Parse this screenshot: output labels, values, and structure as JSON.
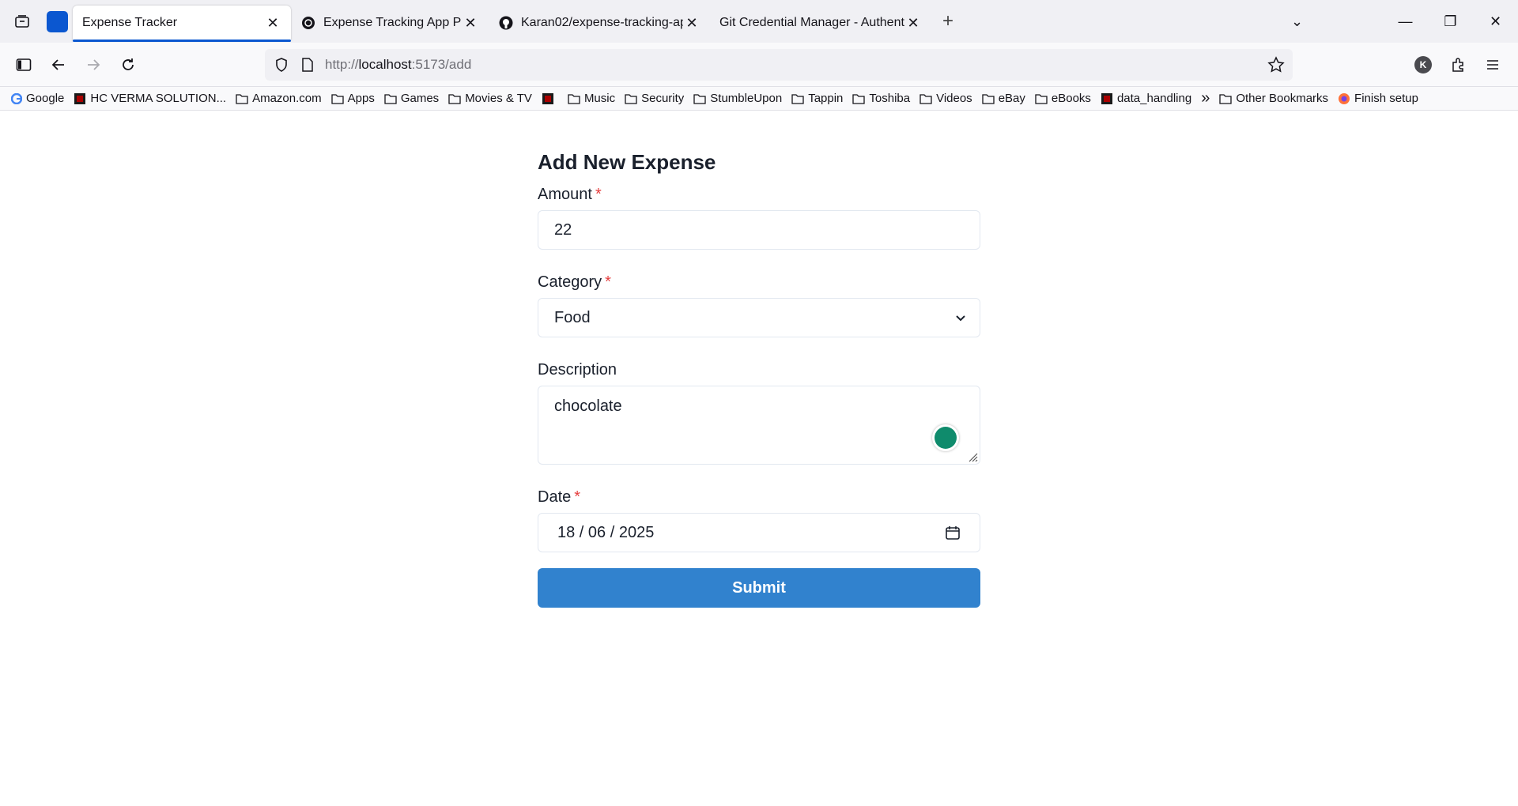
{
  "tabs": [
    {
      "title": "Expense Tracker",
      "active": true
    },
    {
      "title": "Expense Tracking App Plan"
    },
    {
      "title": "Karan02/expense-tracking-app:"
    },
    {
      "title": "Git Credential Manager - Authentica"
    }
  ],
  "url": {
    "prefix": "http://",
    "host": "localhost",
    "path": ":5173/add"
  },
  "account_initial": "K",
  "bookmarks": [
    {
      "label": "Google",
      "icon": "google-icon"
    },
    {
      "label": "HC VERMA SOLUTION...",
      "icon": "site-icon"
    },
    {
      "label": "Amazon.com",
      "icon": "folder-icon"
    },
    {
      "label": "Apps",
      "icon": "folder-icon"
    },
    {
      "label": "Games",
      "icon": "folder-icon"
    },
    {
      "label": "Movies & TV",
      "icon": "folder-icon"
    },
    {
      "label": "",
      "icon": "site-icon"
    },
    {
      "label": "Music",
      "icon": "folder-icon"
    },
    {
      "label": "Security",
      "icon": "folder-icon"
    },
    {
      "label": "StumbleUpon",
      "icon": "folder-icon"
    },
    {
      "label": "Tappin",
      "icon": "folder-icon"
    },
    {
      "label": "Toshiba",
      "icon": "folder-icon"
    },
    {
      "label": "Videos",
      "icon": "folder-icon"
    },
    {
      "label": "eBay",
      "icon": "folder-icon"
    },
    {
      "label": "eBooks",
      "icon": "folder-icon"
    },
    {
      "label": "data_handling",
      "icon": "site-icon"
    }
  ],
  "bookmarks_right": {
    "other": "Other Bookmarks",
    "finish": "Finish setup"
  },
  "form": {
    "title": "Add New Expense",
    "amount_label": "Amount",
    "amount_value": "22",
    "category_label": "Category",
    "category_value": "Food",
    "description_label": "Description",
    "description_value": "chocolate",
    "date_label": "Date",
    "date_value": "18 / 06 / 2025",
    "required_mark": "*",
    "submit_label": "Submit"
  },
  "colors": {
    "accent": "#3182ce",
    "required": "#e53e3e",
    "tab_underline": "#0b57d0"
  }
}
